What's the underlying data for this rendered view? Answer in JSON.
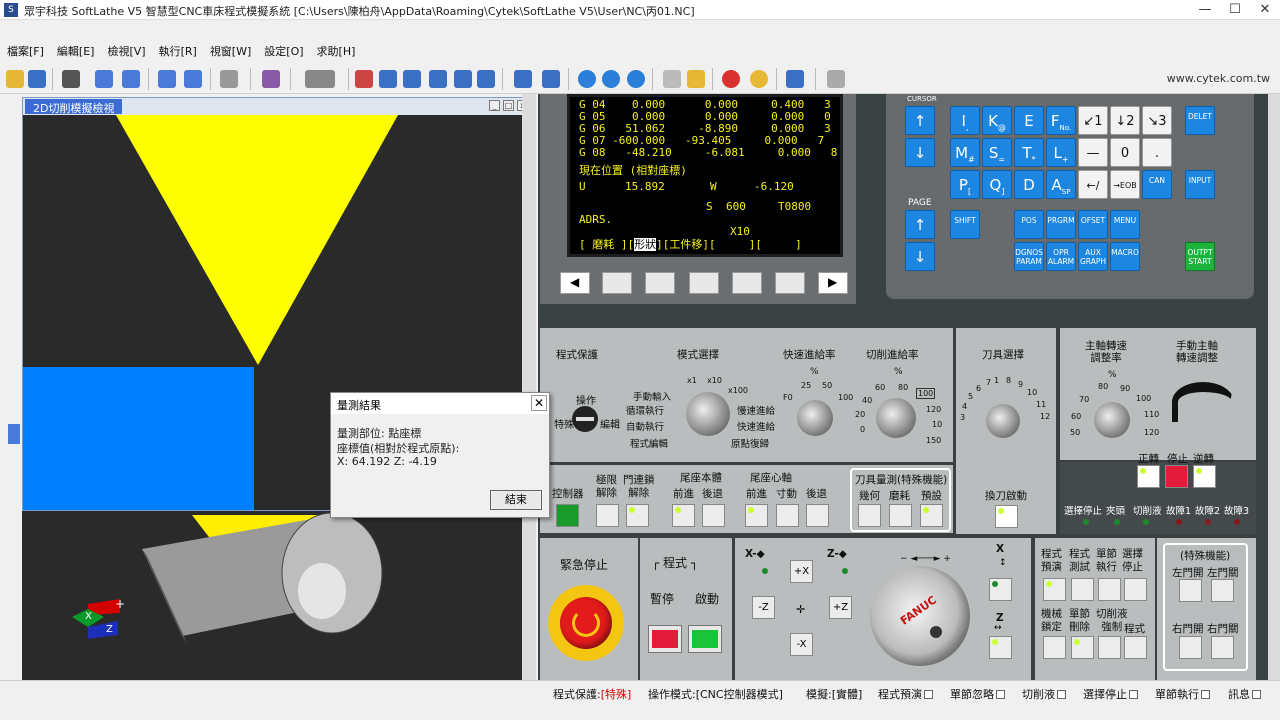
{
  "window": {
    "title": "眾宇科技  SoftLathe  V5  智慧型CNC車床程式模擬系統  [C:\\Users\\陳柏舟\\AppData\\Roaming\\Cytek\\SoftLathe  V5\\User\\NC\\丙01.NC]",
    "minimize": "—",
    "maximize": "☐",
    "close": "✕"
  },
  "menu": [
    "檔案[F]",
    "編輯[E]",
    "檢視[V]",
    "執行[R]",
    "視窗[W]",
    "設定[O]",
    "求助[H]"
  ],
  "toolbar": {
    "website": "www.cytek.com.tw"
  },
  "view2d": {
    "caption": "2D切削模擬檢視"
  },
  "screen": {
    "rows": [
      {
        "g": "G 04",
        "a": "0.000",
        "b": "0.000",
        "c": "0.400",
        "d": "3"
      },
      {
        "g": "G 05",
        "a": "0.000",
        "b": "0.000",
        "c": "0.000",
        "d": "0"
      },
      {
        "g": "G 06",
        "a": "51.062",
        "b": "-8.890",
        "c": "0.000",
        "d": "3"
      },
      {
        "g": "G 07",
        "a": "-600.000",
        "b": "-93.405",
        "c": "0.000",
        "d": "7"
      },
      {
        "g": "G 08",
        "a": "-48.210",
        "b": "-6.081",
        "c": "0.000",
        "d": "8"
      }
    ],
    "pos_title": "現在位置 (相對座標)",
    "u_label": "U",
    "u_value": "15.892",
    "w_label": "W",
    "w_value": "-6.120",
    "s_label": "S",
    "s_value": "600",
    "t_value": "T0800",
    "adrs": "ADRS.",
    "x10": "X10",
    "softkey_bar": "[ 磨耗 ][",
    "softkey_active": "形狀",
    "softkey_bar2": "][工件移][     ][     ]"
  },
  "keypad": {
    "cursor": "CURSOR",
    "page": "PAGE",
    "keys_row1": [
      {
        "main": "I",
        "sub": ","
      },
      {
        "main": "K",
        "sub": "@"
      },
      {
        "main": "E",
        "sub": ""
      },
      {
        "main": "F",
        "sub": "No."
      }
    ],
    "keys_row2": [
      {
        "main": "M",
        "sub": "#"
      },
      {
        "main": "S",
        "sub": "="
      },
      {
        "main": "T",
        "sub": "*"
      },
      {
        "main": "L",
        "sub": "+"
      }
    ],
    "keys_row3": [
      {
        "main": "P",
        "sub": "["
      },
      {
        "main": "Q",
        "sub": "]"
      },
      {
        "main": "D",
        "sub": ""
      },
      {
        "main": "A",
        "sub": "SP"
      }
    ],
    "num_row1": [
      "↙1",
      "↓2",
      "↘3"
    ],
    "num_row2": [
      "—",
      "0",
      "."
    ],
    "num_row3": [
      "←/",
      "→EOB"
    ],
    "delet": "DELET",
    "input": "INPUT",
    "can": "CAN",
    "shift": "SHIFT",
    "pos": "POS",
    "prgrm": "PRGRM",
    "ofset": "OFSET",
    "menu": "MENU",
    "dgnos": "DGNOS PARAM",
    "opr": "OPR ALARM",
    "aux": "AUX GRAPH",
    "macro": "MACRO",
    "output": "OUTPT START"
  },
  "panel": {
    "prog_protect": "程式保護",
    "op": "操作",
    "special": "特殊",
    "edit": "編輯",
    "mode_select": "模式選擇",
    "modes_left": [
      "手動輸入",
      "循環執行",
      "自動執行",
      "程式編輯"
    ],
    "modes_right": [
      "慢速進給",
      "快速進給",
      "原點復歸"
    ],
    "mode_x": [
      "x1",
      "x10",
      "x100"
    ],
    "rapid_rate": "快速進給率",
    "rapid_ticks": [
      "%",
      "25",
      "50",
      "F0",
      "100"
    ],
    "feed_rate": "切削進給率",
    "feed_ticks": [
      "%",
      "60",
      "80",
      "40",
      "100",
      "20",
      "120",
      "0",
      "150",
      "10"
    ],
    "tool_select": "刀具選擇",
    "tool_ticks": [
      "7",
      "6",
      "5",
      "4",
      "3",
      "2",
      "1",
      "8",
      "9",
      "10",
      "11",
      "12"
    ],
    "tool_change": "換刀啟動",
    "spindle_rate": "主軸轉速\n調整率",
    "spindle_ticks": [
      "%",
      "80",
      "90",
      "70",
      "100",
      "60",
      "110",
      "50",
      "120"
    ],
    "manual_spindle": "手動主軸\n轉速調整",
    "fwd": "正轉",
    "stop": "停止",
    "rev": "逆轉",
    "indicators": [
      "選擇停止",
      "夾頭",
      "切削液",
      "故障1",
      "故障2",
      "故障3"
    ],
    "ctrl_power": "控制器",
    "limit_release": "極限\n解除",
    "door_release": "門連鎖\n解除",
    "tail_body": "尾座本體",
    "tail_center": "尾座心軸",
    "fwd_back": [
      "前進",
      "後退",
      "前進",
      "寸動",
      "後退"
    ],
    "tool_measure": "刀具量測(特殊機能)",
    "tool_measure_btns": [
      "幾何",
      "磨耗",
      "預設"
    ],
    "estop": "緊急停止",
    "program": "程式",
    "pause": "暫停",
    "start": "啟動",
    "axes": [
      "X-",
      "Z-",
      "+X",
      "-Z",
      "+Z",
      "-X"
    ],
    "hw_x": "X",
    "hw_z": "Z",
    "fanuc": "FANUC",
    "right_btns": [
      "程式\n預演",
      "程式\n測試",
      "單節\n執行",
      "選擇\n停止",
      "機械\n鎖定",
      "單節\n刪除",
      "切削液\n強制",
      "程式"
    ],
    "special_func": "(特殊機能)",
    "doors": [
      "左門開",
      "左門關",
      "右門開",
      "右門關"
    ]
  },
  "dialog": {
    "title": "量測結果",
    "close": "✕",
    "line1": "量測部位: 點座標",
    "line2": "座標值(相對於程式原點):",
    "line3": "X:  64.192   Z:  -4.19",
    "ok": "結束"
  },
  "axis_glyph": {
    "plus": "+",
    "x": "X",
    "z": "Z"
  },
  "status": [
    {
      "label": "程式保護:",
      "value": "[特殊]"
    },
    {
      "label": "操作模式:[CNC控制器模式]",
      "value": ""
    },
    {
      "label": "模擬:[實體]",
      "value": ""
    },
    {
      "label": "程式預演",
      "value": ""
    },
    {
      "label": "單節忽略",
      "value": ""
    },
    {
      "label": "切削液",
      "value": ""
    },
    {
      "label": "選擇停止",
      "value": ""
    },
    {
      "label": "單節執行",
      "value": ""
    },
    {
      "label": "訊息",
      "value": ""
    }
  ],
  "colors": {
    "yellow": "#ffff00",
    "blue": "#0080ff",
    "panel": "#b9bdbe",
    "key_blue": "#1d86e0",
    "estop_red": "#e21b1b"
  }
}
